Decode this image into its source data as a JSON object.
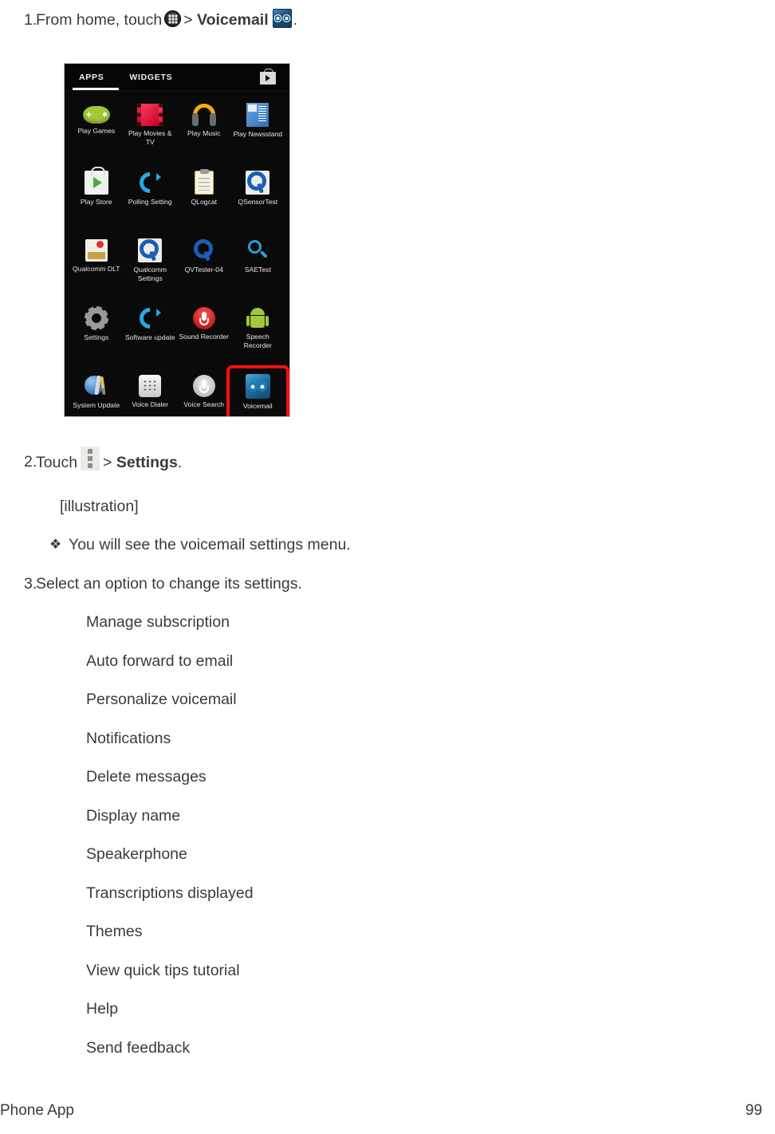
{
  "document": {
    "steps": [
      {
        "number": "1.",
        "text_before": "From home, touch",
        "icon1": "apps-grid-icon",
        "separator": ">",
        "bold_label": "Voicemail",
        "icon2": "voicemail-icon",
        "text_after": "."
      },
      {
        "number": "2.",
        "text_before": "Touch",
        "icon1": "overflow-menu-icon",
        "separator": ">",
        "bold_label": "Settings",
        "text_after": "."
      },
      {
        "number": "3.",
        "text": "Select an option to change its settings."
      }
    ],
    "illustration_placeholder": "[illustration]",
    "note": {
      "bullet": "❖",
      "text": "You will see the voicemail settings menu."
    },
    "options": [
      "Manage subscription",
      "Auto forward to email",
      "Personalize voicemail",
      "Notifications",
      "Delete messages",
      "Display name",
      "Speakerphone",
      "Transcriptions displayed",
      "Themes",
      "View quick tips tutorial",
      "Help",
      "Send feedback"
    ],
    "footer": {
      "left": "Phone App",
      "right": "99"
    }
  },
  "screenshot": {
    "tabs": [
      {
        "label": "APPS",
        "active": true
      },
      {
        "label": "WIDGETS",
        "active": false
      }
    ],
    "store_icon": "play-store-bag-icon",
    "apps": [
      {
        "label": "Play Games",
        "icon": "gamepad-icon",
        "highlighted": false
      },
      {
        "label": "Play Movies\n& TV",
        "icon": "film-strip-icon",
        "highlighted": false
      },
      {
        "label": "Play Music",
        "icon": "headphones-icon",
        "highlighted": false
      },
      {
        "label": "Play\nNewsstand",
        "icon": "newsstand-icon",
        "highlighted": false
      },
      {
        "label": "Play Store",
        "icon": "play-store-icon",
        "highlighted": false
      },
      {
        "label": "Polling\nSetting",
        "icon": "refresh-icon",
        "highlighted": false
      },
      {
        "label": "QLogcat",
        "icon": "clipboard-icon",
        "highlighted": false
      },
      {
        "label": "QSensorTest",
        "icon": "qualcomm-q-icon",
        "highlighted": false
      },
      {
        "label": "Qualcomm\nDLT",
        "icon": "qualcomm-dlt-icon",
        "highlighted": false
      },
      {
        "label": "Qualcomm\nSettings",
        "icon": "qualcomm-settings-icon",
        "highlighted": false
      },
      {
        "label": "QVTester-04",
        "icon": "qualcomm-q-icon",
        "highlighted": false
      },
      {
        "label": "SAETest",
        "icon": "magnifier-icon",
        "highlighted": false
      },
      {
        "label": "Settings",
        "icon": "gear-icon",
        "highlighted": false
      },
      {
        "label": "Software\nupdate",
        "icon": "refresh-icon",
        "highlighted": false
      },
      {
        "label": "Sound\nRecorder",
        "icon": "red-microphone-icon",
        "highlighted": false
      },
      {
        "label": "Speech\nRecorder",
        "icon": "android-robot-icon",
        "highlighted": false
      },
      {
        "label": "System\nUpdate",
        "icon": "system-update-icon",
        "highlighted": false
      },
      {
        "label": "Voice Dialer",
        "icon": "dialpad-icon",
        "highlighted": false
      },
      {
        "label": "Voice Search",
        "icon": "microphone-icon",
        "highlighted": false
      },
      {
        "label": "Voicemail",
        "icon": "voicemail-icon",
        "highlighted": true
      }
    ],
    "highlight_color": "#f50f0f"
  }
}
